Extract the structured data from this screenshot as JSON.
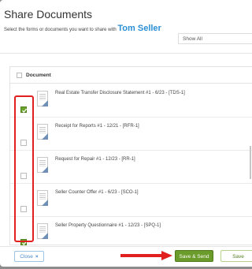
{
  "dialog": {
    "title": "Share Documents",
    "subtitle": "Select the forms or documents you want to share with",
    "recipient": "Tom Seller",
    "filter": {
      "value": "Show All"
    }
  },
  "table": {
    "column_header": "Document",
    "rows": [
      {
        "label": "Real Estate Transfer Disclosure Statement #1 - 6/23 - [TDS-1]",
        "checked": true
      },
      {
        "label": "Receipt for Reports #1 - 12/21 - [RFR-1]",
        "checked": false
      },
      {
        "label": "Request for Repair #1 - 12/23 - [RR-1]",
        "checked": false
      },
      {
        "label": "Seller Counter Offer #1 - 6/23 - [SCO-1]",
        "checked": false
      },
      {
        "label": "Seller Property Questionnaire #1 - 12/23 - [SPQ-1]",
        "checked": true
      }
    ]
  },
  "footer": {
    "close_label": "Close",
    "close_icon": "×",
    "save_send_label": "Save & Send",
    "save_label": "Save"
  },
  "colors": {
    "accent": "#2b8fd6",
    "primary_button": "#6a9b2b",
    "highlight": "#e11f1f",
    "checkbox_checked": "#6aa329"
  }
}
